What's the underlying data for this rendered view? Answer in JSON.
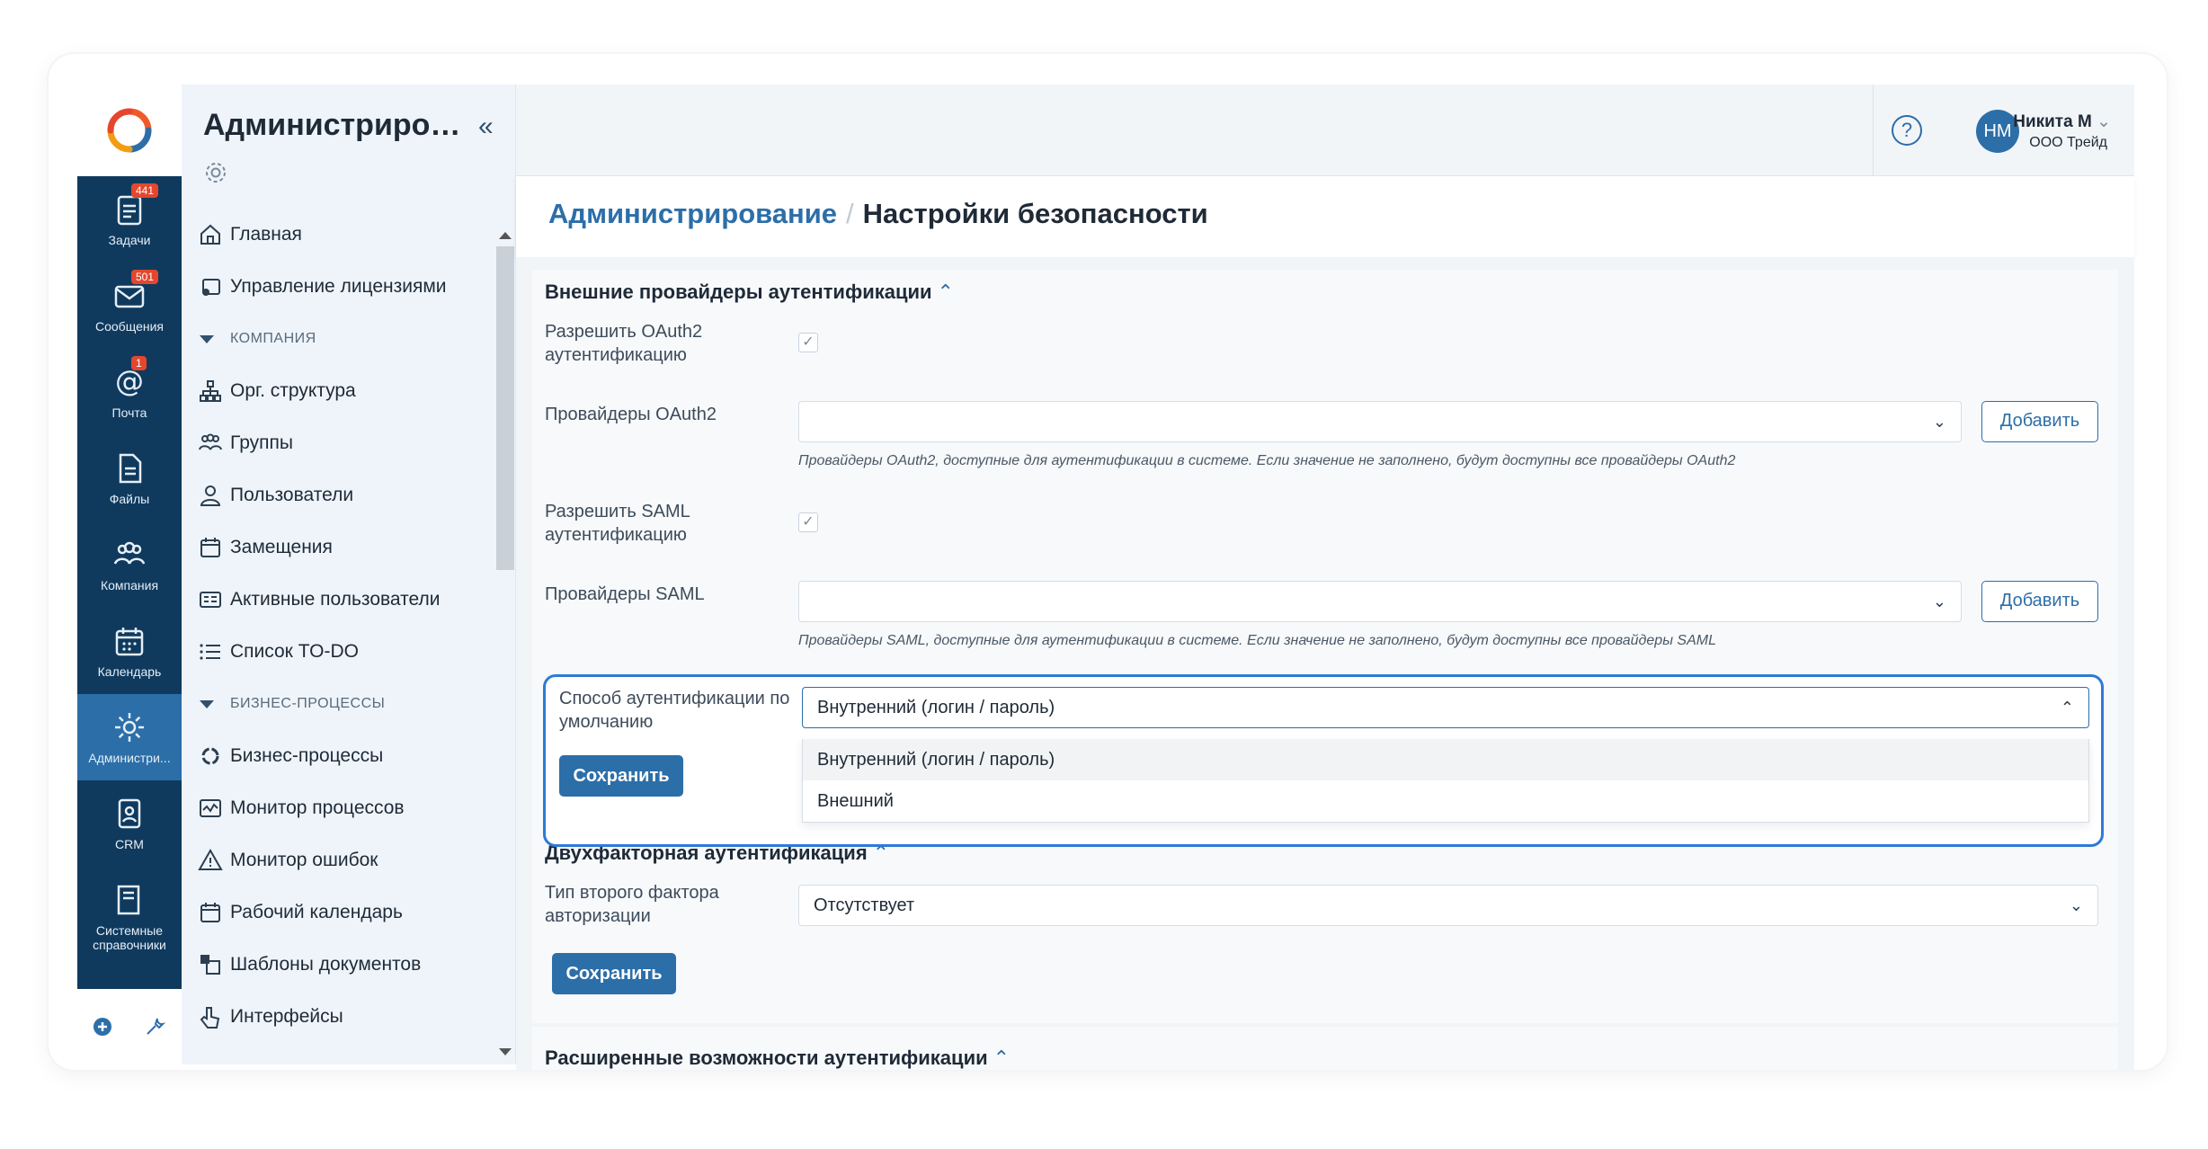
{
  "rail": {
    "items": [
      {
        "label": "Задачи",
        "badge": "441",
        "icon": "tasks-icon"
      },
      {
        "label": "Сообщения",
        "badge": "501",
        "icon": "messages-icon"
      },
      {
        "label": "Почта",
        "badge": "1",
        "icon": "mail-icon"
      },
      {
        "label": "Файлы",
        "badge": "",
        "icon": "files-icon"
      },
      {
        "label": "Компания",
        "badge": "",
        "icon": "company-icon"
      },
      {
        "label": "Календарь",
        "badge": "",
        "icon": "calendar-icon"
      },
      {
        "label": "Администри...",
        "badge": "",
        "icon": "gear-icon"
      },
      {
        "label": "CRM",
        "badge": "",
        "icon": "crm-icon"
      },
      {
        "label": "Системные справочники",
        "badge": "",
        "icon": "book-icon"
      }
    ]
  },
  "sidebar": {
    "title": "Администриров...",
    "collapse_label": "«",
    "items": {
      "home": "Главная",
      "licenses": "Управление лицензиями",
      "group_company": "КОМПАНИЯ",
      "org": "Орг. структура",
      "groups": "Группы",
      "users": "Пользователи",
      "subst": "Замещения",
      "active_users": "Активные пользователи",
      "todo": "Список TO-DO",
      "group_bp": "БИЗНЕС-ПРОЦЕССЫ",
      "bp": "Бизнес-процессы",
      "monitor": "Монитор процессов",
      "errors": "Монитор ошибок",
      "work_cal": "Рабочий календарь",
      "templates": "Шаблоны документов",
      "interfaces": "Интерфейсы"
    }
  },
  "header": {
    "help": "?",
    "avatar_initials": "НМ",
    "user_name": "Никита М",
    "user_org": "ООО Трейд"
  },
  "breadcrumb": {
    "root": "Администрирование",
    "sep": "/",
    "current": "Настройки безопасности"
  },
  "external": {
    "title": "Внешние провайдеры аутентификации",
    "oauth_allow_label": "Разрешить OAuth2 аутентификацию",
    "oauth_checked": true,
    "oauth_providers_label": "Провайдеры OAuth2",
    "oauth_providers_value": "",
    "add_label": "Добавить",
    "oauth_hint": "Провайдеры OAuth2, доступные для аутентификации в системе. Если значение не заполнено, будут доступны все провайдеры OAuth2",
    "saml_allow_label": "Разрешить SAML аутентификацию",
    "saml_checked": true,
    "saml_providers_label": "Провайдеры SAML",
    "saml_providers_value": "",
    "saml_hint": "Провайдеры SAML, доступные для аутентификации в системе. Если значение не заполнено, будут доступны все провайдеры SAML",
    "default_method_label": "Способ аутентификации по умолчанию",
    "default_method_value": "Внутренний (логин / пароль)",
    "default_method_options": [
      "Внутренний (логин / пароль)",
      "Внешний"
    ],
    "save_label": "Сохранить"
  },
  "twofa": {
    "title": "Двухфакторная аутентификация",
    "type_label": "Тип второго фактора авторизации",
    "type_value": "Отсутствует",
    "save_label": "Сохранить"
  },
  "advanced": {
    "title": "Расширенные возможности аутентификации"
  },
  "colors": {
    "accent": "#2c6ea8",
    "rail": "#0f3a5e",
    "highlight": "#2f7ad6",
    "badge": "#e4472d"
  }
}
